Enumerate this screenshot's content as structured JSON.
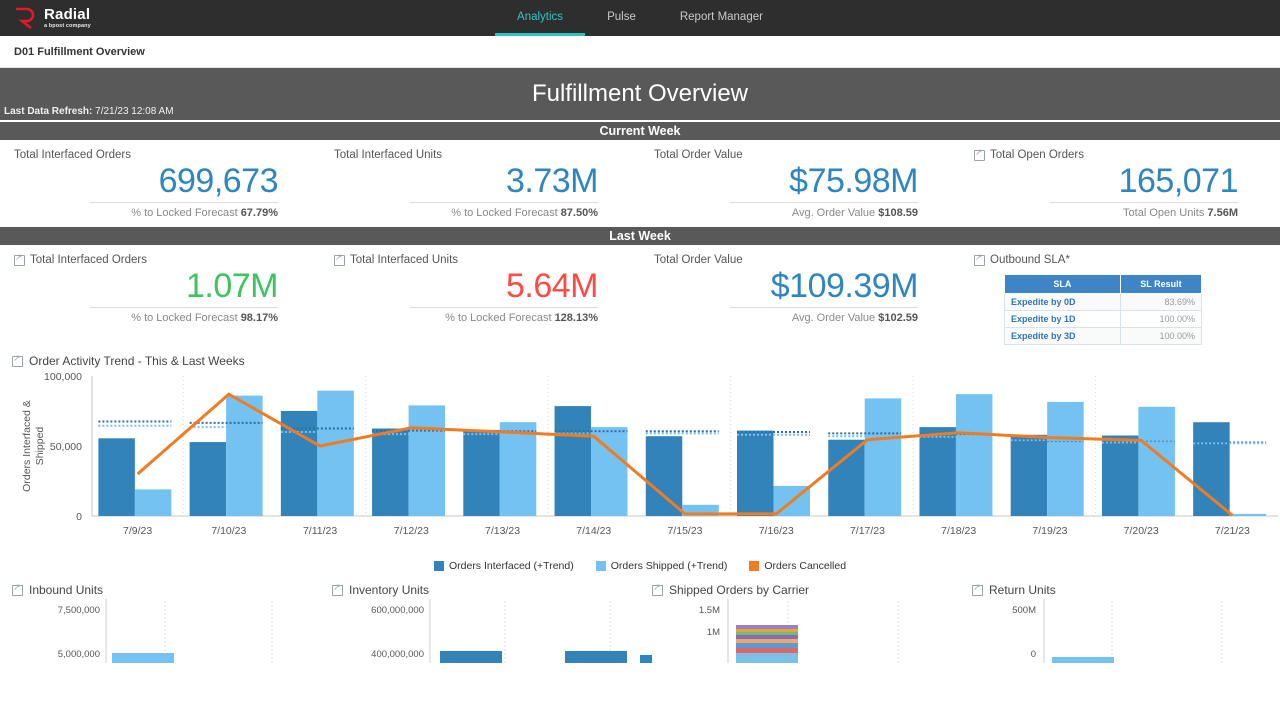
{
  "header": {
    "brand_name": "Radial",
    "brand_tagline": "a bpost company",
    "nav": [
      {
        "label": "Analytics",
        "active": true
      },
      {
        "label": "Pulse",
        "active": false
      },
      {
        "label": "Report Manager",
        "active": false
      }
    ]
  },
  "breadcrumb": "D01 Fulfillment Overview",
  "page_title": "Fulfillment Overview",
  "refresh_label": "Last Data Refresh:",
  "refresh_value": "7/21/23 12:08 AM",
  "sections": {
    "current_week": "Current Week",
    "last_week": "Last Week"
  },
  "current_week_kpis": [
    {
      "label": "Total Interfaced Orders",
      "value": "699,673",
      "sub_label": "% to Locked Forecast",
      "sub_value": "67.79%",
      "color": "#2e86c1",
      "has_drill": false
    },
    {
      "label": "Total Interfaced Units",
      "value": "3.73M",
      "sub_label": "% to Locked Forecast",
      "sub_value": "87.50%",
      "color": "#2e86c1",
      "has_drill": false
    },
    {
      "label": "Total Order Value",
      "value": "$75.98M",
      "sub_label": "Avg. Order Value",
      "sub_value": "$108.59",
      "color": "#2e86c1",
      "has_drill": false
    },
    {
      "label": "Total Open Orders",
      "value": "165,071",
      "sub_label": "Total Open Units",
      "sub_value": "7.56M",
      "color": "#2e86c1",
      "has_drill": true
    }
  ],
  "last_week_kpis": [
    {
      "label": "Total Interfaced Orders",
      "value": "1.07M",
      "sub_label": "% to Locked Forecast",
      "sub_value": "98.17%",
      "color": "#3dc35f",
      "has_drill": true
    },
    {
      "label": "Total Interfaced Units",
      "value": "5.64M",
      "sub_label": "% to Locked Forecast",
      "sub_value": "128.13%",
      "color": "#fb4b42",
      "has_drill": true
    },
    {
      "label": "Total Order Value",
      "value": "$109.39M",
      "sub_label": "Avg. Order Value",
      "sub_value": "$102.59",
      "color": "#2e86c1",
      "has_drill": false
    }
  ],
  "outbound_sla": {
    "title": "Outbound SLA*",
    "columns": [
      "SLA",
      "SL Result"
    ],
    "rows": [
      {
        "sla": "Expedite by 0D",
        "result": "83.69%"
      },
      {
        "sla": "Expedite by 1D",
        "result": "100.00%"
      },
      {
        "sla": "Expedite by 3D",
        "result": "100.00%"
      }
    ]
  },
  "chart_data": {
    "type": "bar",
    "title": "Order Activity Trend - This & Last Weeks",
    "xlabel": "",
    "ylabel": "Orders Interfaced & Shipped",
    "ylim": [
      0,
      100000
    ],
    "yticks": [
      "0",
      "50,000",
      "100,000"
    ],
    "grid": true,
    "legend_position": "bottom",
    "categories": [
      "7/9/23",
      "7/10/23",
      "7/11/23",
      "7/12/23",
      "7/13/23",
      "7/14/23",
      "7/15/23",
      "7/16/23",
      "7/17/23",
      "7/18/23",
      "7/19/23",
      "7/20/23",
      "7/21/23"
    ],
    "series": [
      {
        "name": "Orders Interfaced (+Trend)",
        "type": "bar",
        "color": "#3383bb",
        "values": [
          55500,
          52800,
          75000,
          62500,
          61500,
          78500,
          57000,
          61000,
          54500,
          63500,
          58000,
          57500,
          67000
        ]
      },
      {
        "name": "Orders Shipped (+Trend)",
        "type": "bar",
        "color": "#73c2f2",
        "values": [
          19000,
          86000,
          89500,
          79000,
          67000,
          63500,
          8000,
          21500,
          84000,
          87000,
          81500,
          78000,
          1500
        ]
      },
      {
        "name": "Orders Cancelled",
        "type": "line",
        "color": "#f07c22",
        "values": [
          30000,
          87000,
          50000,
          63000,
          60000,
          57000,
          1500,
          1500,
          54500,
          59500,
          56000,
          54000,
          500
        ]
      },
      {
        "name": "Orders Interfaced Trend",
        "type": "trend-dotted",
        "color": "#2e6f9e",
        "values": [
          67500,
          66500,
          62500,
          61000,
          60500,
          60500,
          60500,
          60000,
          59000,
          58500,
          53500,
          53000,
          52500
        ]
      },
      {
        "name": "Orders Shipped Trend",
        "type": "trend-dotted",
        "color": "#73c2f2",
        "values": [
          64500,
          63500,
          60000,
          58500,
          58500,
          59000,
          59000,
          58000,
          57000,
          56500,
          54000,
          52500,
          52000
        ]
      }
    ]
  },
  "mini_charts": [
    {
      "title": "Inbound Units",
      "yticks": [
        "7,500,000",
        "5,000,000"
      ],
      "bars": [
        {
          "color": "#73c2f2",
          "height": 10,
          "left": 110,
          "width": 62
        }
      ]
    },
    {
      "title": "Inventory Units",
      "yticks": [
        "600,000,000",
        "400,000,000"
      ],
      "bars": [
        {
          "color": "#3383bb",
          "height": 12,
          "left": 100,
          "width": 62
        },
        {
          "color": "#3383bb",
          "height": 12,
          "left": 200,
          "width": 62
        }
      ]
    },
    {
      "title": "Shipped Orders by Carrier",
      "yticks": [
        "1.5M",
        "1M"
      ],
      "bars": [
        {
          "color": "stacked",
          "height": 40,
          "left": 85,
          "width": 62
        }
      ]
    },
    {
      "title": "Return Units",
      "yticks": [
        "500M",
        "0"
      ],
      "bars": [
        {
          "color": "#73c2f2",
          "height": 6,
          "left": 78,
          "width": 62
        }
      ]
    }
  ]
}
